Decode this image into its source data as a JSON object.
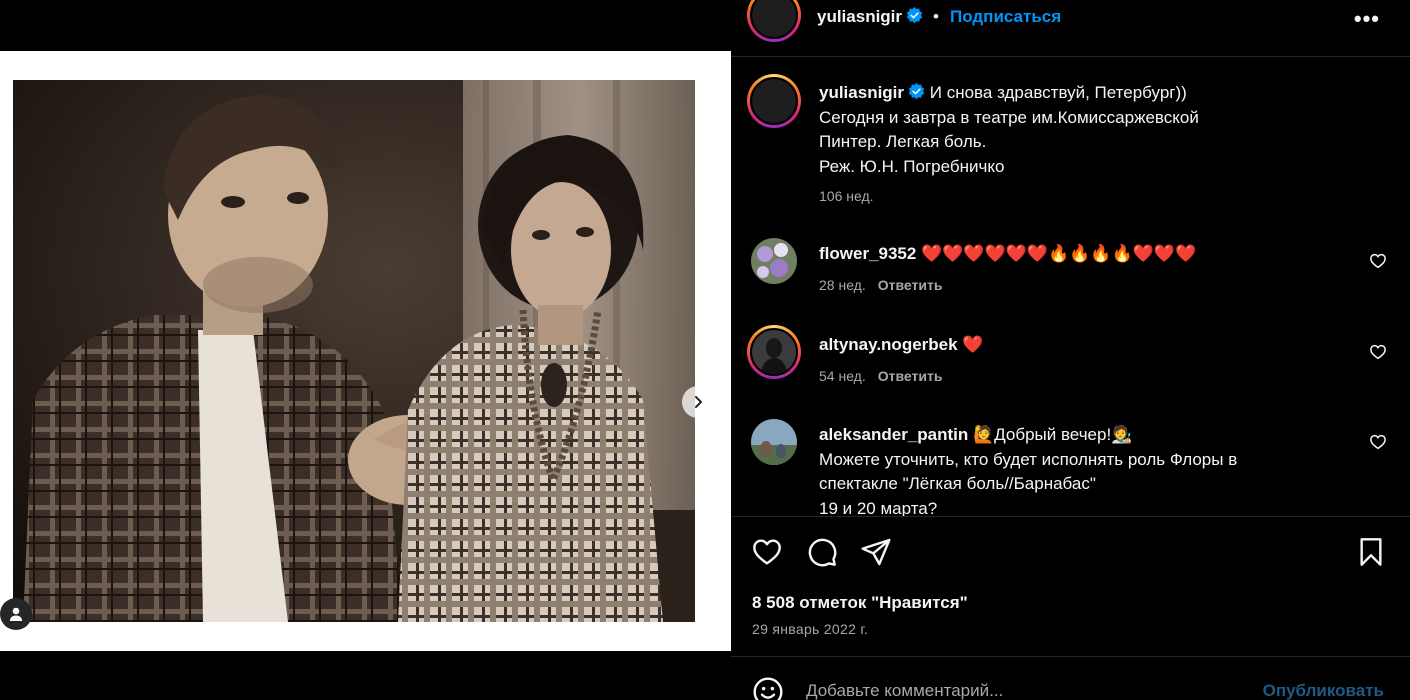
{
  "post": {
    "username": "yuliasnigir",
    "dot": "•",
    "follow_label": "Подписаться",
    "more_icon": "more-horizontal-icon",
    "more_label": "•••"
  },
  "caption": {
    "username": "yuliasnigir",
    "line1": "И снова здравствуй, Петербург))",
    "line2": "Сегодня и завтра в театре им.Комиссаржевской",
    "line3": "Пинтер. Легкая боль.",
    "line4": "Реж. Ю.Н. Погребничко",
    "time": "106 нед."
  },
  "comments": [
    {
      "username": "flower_9352",
      "text": "❤️❤️❤️❤️❤️❤️🔥🔥🔥🔥❤️❤️❤️",
      "time": "28 нед.",
      "reply_label": "Ответить"
    },
    {
      "username": "altynay.nogerbek",
      "text": "❤️",
      "time": "54 нед.",
      "reply_label": "Ответить"
    },
    {
      "username": "aleksander_pantin",
      "line1": "🙋Добрый вечер!🧑‍🎨",
      "line2": "Можете уточнить, кто будет исполнять роль Флоры в",
      "line3": "спектакле \"Лёгкая боль//Барнабас\"",
      "line4": "19 и 20 марта?"
    }
  ],
  "likes_text": "8 508 отметок \"Нравится\"",
  "date_text": "29 январь 2022 г.",
  "comment_box": {
    "placeholder": "Добавьте комментарий...",
    "publish_label": "Опубликовать"
  },
  "colors": {
    "accent": "#0095f6",
    "publish_disabled": "#1e5a86",
    "secondary_text": "#a8a8a8",
    "heart": "#ed1c3a"
  }
}
